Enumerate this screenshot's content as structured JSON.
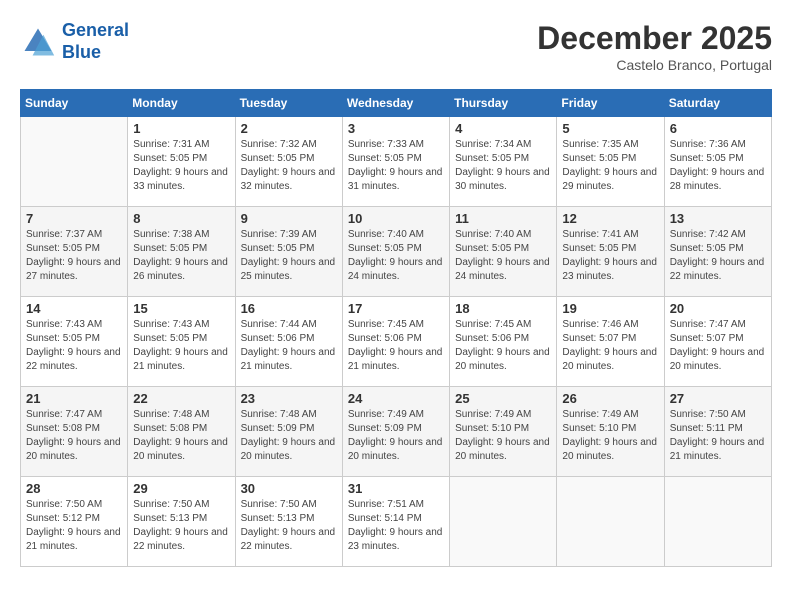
{
  "logo": {
    "line1": "General",
    "line2": "Blue"
  },
  "title": "December 2025",
  "location": "Castelo Branco, Portugal",
  "header": {
    "days": [
      "Sunday",
      "Monday",
      "Tuesday",
      "Wednesday",
      "Thursday",
      "Friday",
      "Saturday"
    ]
  },
  "weeks": [
    [
      {
        "day": "",
        "sunrise": "",
        "sunset": "",
        "daylight": ""
      },
      {
        "day": "1",
        "sunrise": "Sunrise: 7:31 AM",
        "sunset": "Sunset: 5:05 PM",
        "daylight": "Daylight: 9 hours and 33 minutes."
      },
      {
        "day": "2",
        "sunrise": "Sunrise: 7:32 AM",
        "sunset": "Sunset: 5:05 PM",
        "daylight": "Daylight: 9 hours and 32 minutes."
      },
      {
        "day": "3",
        "sunrise": "Sunrise: 7:33 AM",
        "sunset": "Sunset: 5:05 PM",
        "daylight": "Daylight: 9 hours and 31 minutes."
      },
      {
        "day": "4",
        "sunrise": "Sunrise: 7:34 AM",
        "sunset": "Sunset: 5:05 PM",
        "daylight": "Daylight: 9 hours and 30 minutes."
      },
      {
        "day": "5",
        "sunrise": "Sunrise: 7:35 AM",
        "sunset": "Sunset: 5:05 PM",
        "daylight": "Daylight: 9 hours and 29 minutes."
      },
      {
        "day": "6",
        "sunrise": "Sunrise: 7:36 AM",
        "sunset": "Sunset: 5:05 PM",
        "daylight": "Daylight: 9 hours and 28 minutes."
      }
    ],
    [
      {
        "day": "7",
        "sunrise": "Sunrise: 7:37 AM",
        "sunset": "Sunset: 5:05 PM",
        "daylight": "Daylight: 9 hours and 27 minutes."
      },
      {
        "day": "8",
        "sunrise": "Sunrise: 7:38 AM",
        "sunset": "Sunset: 5:05 PM",
        "daylight": "Daylight: 9 hours and 26 minutes."
      },
      {
        "day": "9",
        "sunrise": "Sunrise: 7:39 AM",
        "sunset": "Sunset: 5:05 PM",
        "daylight": "Daylight: 9 hours and 25 minutes."
      },
      {
        "day": "10",
        "sunrise": "Sunrise: 7:40 AM",
        "sunset": "Sunset: 5:05 PM",
        "daylight": "Daylight: 9 hours and 24 minutes."
      },
      {
        "day": "11",
        "sunrise": "Sunrise: 7:40 AM",
        "sunset": "Sunset: 5:05 PM",
        "daylight": "Daylight: 9 hours and 24 minutes."
      },
      {
        "day": "12",
        "sunrise": "Sunrise: 7:41 AM",
        "sunset": "Sunset: 5:05 PM",
        "daylight": "Daylight: 9 hours and 23 minutes."
      },
      {
        "day": "13",
        "sunrise": "Sunrise: 7:42 AM",
        "sunset": "Sunset: 5:05 PM",
        "daylight": "Daylight: 9 hours and 22 minutes."
      }
    ],
    [
      {
        "day": "14",
        "sunrise": "Sunrise: 7:43 AM",
        "sunset": "Sunset: 5:05 PM",
        "daylight": "Daylight: 9 hours and 22 minutes."
      },
      {
        "day": "15",
        "sunrise": "Sunrise: 7:43 AM",
        "sunset": "Sunset: 5:05 PM",
        "daylight": "Daylight: 9 hours and 21 minutes."
      },
      {
        "day": "16",
        "sunrise": "Sunrise: 7:44 AM",
        "sunset": "Sunset: 5:06 PM",
        "daylight": "Daylight: 9 hours and 21 minutes."
      },
      {
        "day": "17",
        "sunrise": "Sunrise: 7:45 AM",
        "sunset": "Sunset: 5:06 PM",
        "daylight": "Daylight: 9 hours and 21 minutes."
      },
      {
        "day": "18",
        "sunrise": "Sunrise: 7:45 AM",
        "sunset": "Sunset: 5:06 PM",
        "daylight": "Daylight: 9 hours and 20 minutes."
      },
      {
        "day": "19",
        "sunrise": "Sunrise: 7:46 AM",
        "sunset": "Sunset: 5:07 PM",
        "daylight": "Daylight: 9 hours and 20 minutes."
      },
      {
        "day": "20",
        "sunrise": "Sunrise: 7:47 AM",
        "sunset": "Sunset: 5:07 PM",
        "daylight": "Daylight: 9 hours and 20 minutes."
      }
    ],
    [
      {
        "day": "21",
        "sunrise": "Sunrise: 7:47 AM",
        "sunset": "Sunset: 5:08 PM",
        "daylight": "Daylight: 9 hours and 20 minutes."
      },
      {
        "day": "22",
        "sunrise": "Sunrise: 7:48 AM",
        "sunset": "Sunset: 5:08 PM",
        "daylight": "Daylight: 9 hours and 20 minutes."
      },
      {
        "day": "23",
        "sunrise": "Sunrise: 7:48 AM",
        "sunset": "Sunset: 5:09 PM",
        "daylight": "Daylight: 9 hours and 20 minutes."
      },
      {
        "day": "24",
        "sunrise": "Sunrise: 7:49 AM",
        "sunset": "Sunset: 5:09 PM",
        "daylight": "Daylight: 9 hours and 20 minutes."
      },
      {
        "day": "25",
        "sunrise": "Sunrise: 7:49 AM",
        "sunset": "Sunset: 5:10 PM",
        "daylight": "Daylight: 9 hours and 20 minutes."
      },
      {
        "day": "26",
        "sunrise": "Sunrise: 7:49 AM",
        "sunset": "Sunset: 5:10 PM",
        "daylight": "Daylight: 9 hours and 20 minutes."
      },
      {
        "day": "27",
        "sunrise": "Sunrise: 7:50 AM",
        "sunset": "Sunset: 5:11 PM",
        "daylight": "Daylight: 9 hours and 21 minutes."
      }
    ],
    [
      {
        "day": "28",
        "sunrise": "Sunrise: 7:50 AM",
        "sunset": "Sunset: 5:12 PM",
        "daylight": "Daylight: 9 hours and 21 minutes."
      },
      {
        "day": "29",
        "sunrise": "Sunrise: 7:50 AM",
        "sunset": "Sunset: 5:13 PM",
        "daylight": "Daylight: 9 hours and 22 minutes."
      },
      {
        "day": "30",
        "sunrise": "Sunrise: 7:50 AM",
        "sunset": "Sunset: 5:13 PM",
        "daylight": "Daylight: 9 hours and 22 minutes."
      },
      {
        "day": "31",
        "sunrise": "Sunrise: 7:51 AM",
        "sunset": "Sunset: 5:14 PM",
        "daylight": "Daylight: 9 hours and 23 minutes."
      },
      {
        "day": "",
        "sunrise": "",
        "sunset": "",
        "daylight": ""
      },
      {
        "day": "",
        "sunrise": "",
        "sunset": "",
        "daylight": ""
      },
      {
        "day": "",
        "sunrise": "",
        "sunset": "",
        "daylight": ""
      }
    ]
  ]
}
